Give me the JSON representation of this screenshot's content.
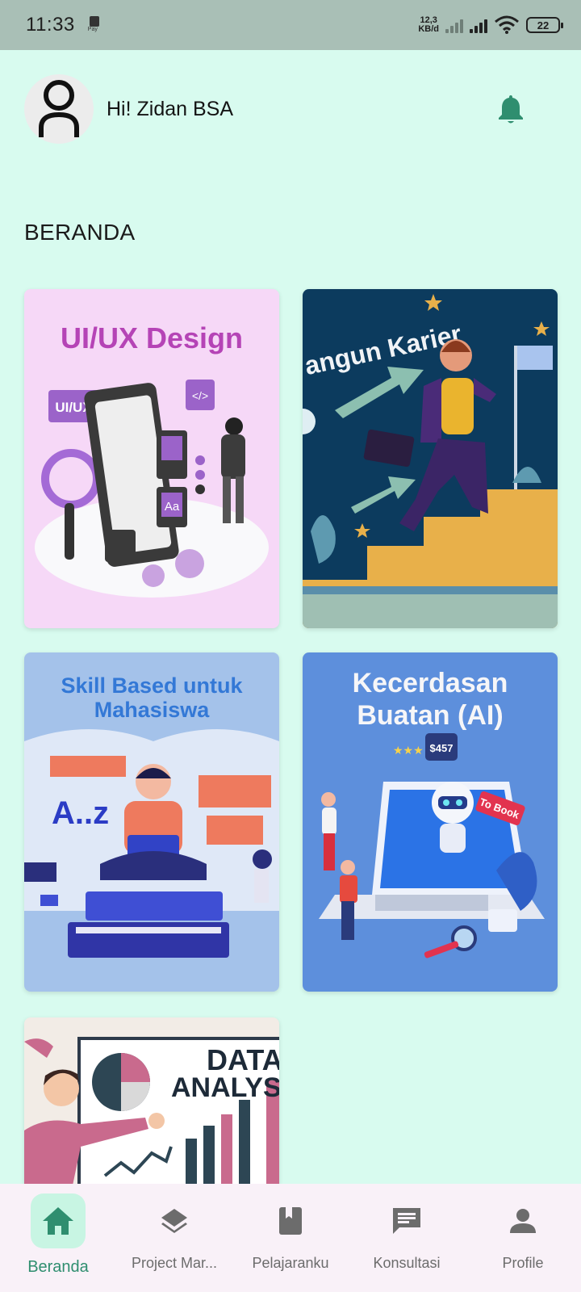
{
  "status": {
    "time": "11:33",
    "pay": "Pay",
    "speed_top": "12,3",
    "speed_bottom": "KB/d",
    "battery": "22"
  },
  "header": {
    "greeting": "Hi! Zidan BSA"
  },
  "section_title": "BERANDA",
  "cards": [
    {
      "title": "UI/UX Design"
    },
    {
      "title": "angun Karier"
    },
    {
      "title_line1": "Skill Based untuk",
      "title_line2": "Mahasiswa"
    },
    {
      "title_line1": "Kecerdasan",
      "title_line2": "Buatan (AI)"
    },
    {
      "title_line1": "DATA",
      "title_line2": "ANALYST"
    }
  ],
  "card_art_text": {
    "uiux_tag": "UI/UX",
    "code_tag": "</>",
    "aa_tag": "Aa",
    "az": "A..z",
    "price": "$457",
    "to_book": "To Book"
  },
  "nav": [
    {
      "label": "Beranda",
      "icon": "home-icon",
      "active": true
    },
    {
      "label": "Project Mar...",
      "icon": "layers-icon",
      "active": false
    },
    {
      "label": "Pelajaranku",
      "icon": "book-icon",
      "active": false
    },
    {
      "label": "Konsultasi",
      "icon": "chat-icon",
      "active": false
    },
    {
      "label": "Profile",
      "icon": "person-icon",
      "active": false
    }
  ],
  "colors": {
    "accent": "#2f8e6f",
    "background": "#d8fbef",
    "nav_active_bg": "#c8f5e3"
  }
}
